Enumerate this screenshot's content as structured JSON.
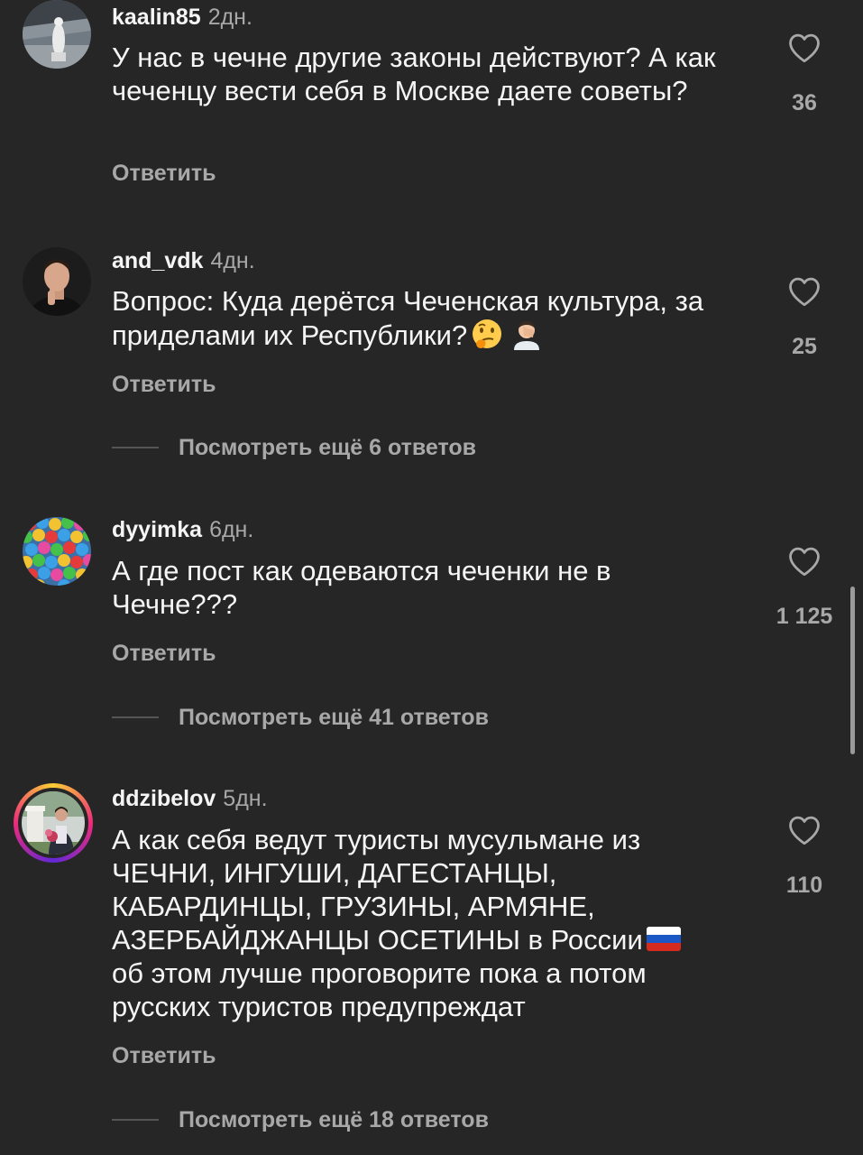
{
  "comments": [
    {
      "username": "kaalin85",
      "time": "2дн.",
      "text": "У нас в чечне другие законы действуют? А как чеченцу вести себя в Москве даете советы?",
      "reply_label": "Ответить",
      "likes": "36",
      "avatar_icon": "avatar-photo-statue"
    },
    {
      "username": "and_vdk",
      "time": "4дн.",
      "text": "Вопрос: Куда дерётся Чеченская культура, за приделами их Республики?",
      "emojis": [
        "thinking-face-emoji",
        "facepalm-emoji"
      ],
      "reply_label": "Ответить",
      "likes": "25",
      "more_replies": "Посмотреть ещё 6 ответов",
      "avatar_icon": "avatar-photo-man"
    },
    {
      "username": "dyyimka",
      "time": "6дн.",
      "text": "А где пост как одеваются чеченки не в Чечне???",
      "reply_label": "Ответить",
      "likes": "1 125",
      "more_replies": "Посмотреть ещё 41 ответов",
      "avatar_icon": "avatar-photo-balls"
    },
    {
      "username": "ddzibelov",
      "time": "5дн.",
      "text": "А как себя ведут туристы мусульмане из ЧЕЧНИ, ИНГУШИ, ДАГЕСТАНЦЫ, КАБАРДИНЦЫ, ГРУЗИНЫ, АРМЯНЕ, АЗЕРБАЙДЖАНЦЫ ОСЕТИНЫ в России",
      "text_after": "об этом лучше проговорите пока а потом русских туристов предупреждат",
      "flag_icon": "russia-flag-emoji",
      "reply_label": "Ответить",
      "likes": "110",
      "more_replies": "Посмотреть ещё 18 ответов",
      "avatar_icon": "avatar-photo-man-with-flowers",
      "avatar_story_ring": true
    }
  ],
  "colors": {
    "background": "#262626",
    "primary_text": "#f5f5f5",
    "secondary_text": "#a8a8a8"
  }
}
